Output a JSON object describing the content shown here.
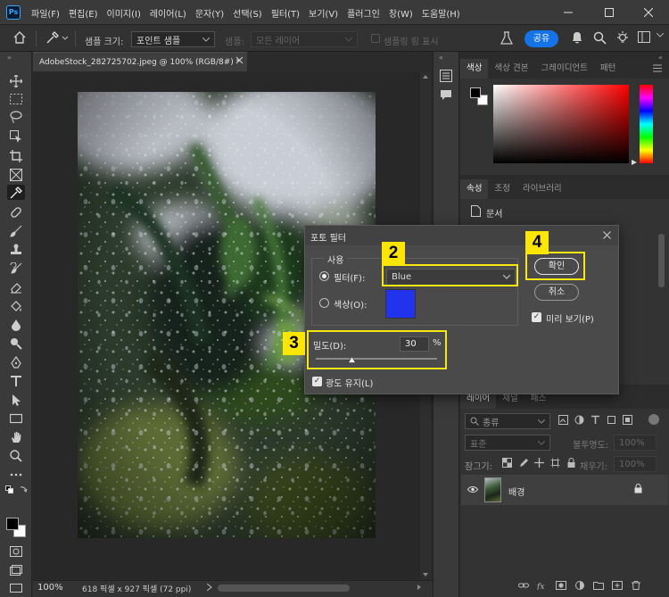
{
  "menubar": {
    "app_icon": "Ps",
    "menus": [
      "파일(F)",
      "편집(E)",
      "이미지(I)",
      "레이어(L)",
      "문자(Y)",
      "선택(S)",
      "필터(T)",
      "보기(V)",
      "플러그인",
      "창(W)",
      "도움말(H)"
    ]
  },
  "options": {
    "sample_size_label": "샘플 크기:",
    "sample_size_value": "포인트 샘플",
    "sample_label": "샘플:",
    "sample_value": "모든 레이어",
    "show_ring_label": "샘플링 링 표시",
    "share_label": "공유"
  },
  "document": {
    "tab_title": "AdobeStock_282725702.jpeg @ 100% (RGB/8#) *",
    "zoom": "100%",
    "dimensions": "618 픽셀 x 927 픽셀 (72 ppi)"
  },
  "color_panel": {
    "tabs": [
      "색상",
      "색상 견본",
      "그레이디언트",
      "패턴"
    ]
  },
  "properties_panel": {
    "tabs": [
      "속성",
      "조정",
      "라이브러리"
    ],
    "doc_label": "문서"
  },
  "layers_panel": {
    "tabs": [
      "레이어",
      "채널",
      "패스"
    ],
    "search_placeholder": "종류",
    "blend_mode": "표준",
    "opacity_label": "불투명도:",
    "opacity_value": "100%",
    "lock_label": "잠그기:",
    "fill_label": "채우기:",
    "fill_value": "100%",
    "layer_name": "배경"
  },
  "dialog": {
    "title": "포토 필터",
    "use_label": "사용",
    "filter_label": "필터(F):",
    "filter_value": "Blue",
    "color_label": "색상(O):",
    "color_swatch": "#2233ee",
    "density_label": "밀도(D):",
    "density_value": "30",
    "density_unit": "%",
    "density_level_percent": 30,
    "preserve_label": "광도 유지(L)",
    "ok_label": "확인",
    "cancel_label": "취소",
    "preview_label": "미리 보기(P)"
  },
  "annotations": {
    "badge_2": "2",
    "badge_3": "3",
    "badge_4": "4",
    "highlight_color": "#f5e70f"
  }
}
